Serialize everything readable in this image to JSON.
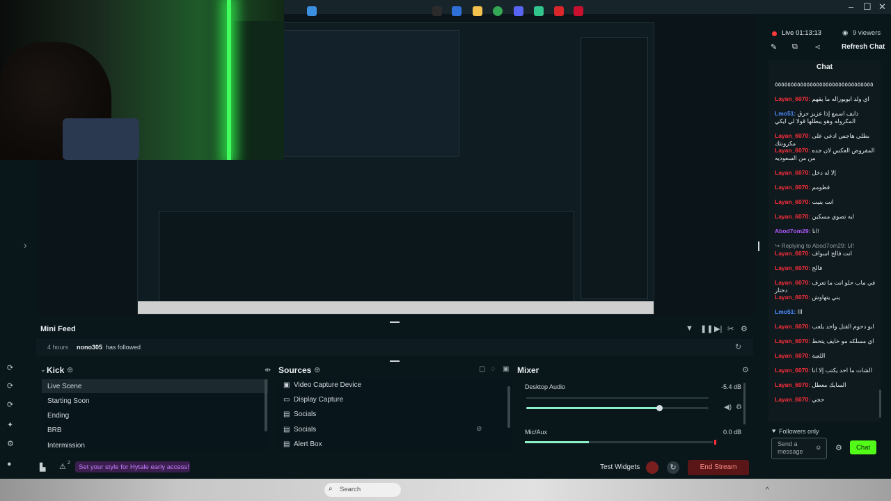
{
  "stream": {
    "live_label": "Live 01:13:13",
    "viewers_label": "9 viewers",
    "refresh_chat": "Refresh Chat",
    "chat_title": "Chat"
  },
  "minifeed": {
    "title": "Mini Feed",
    "time": "4 hours",
    "user": "nono305",
    "action": "has followed"
  },
  "scenes": {
    "title": "Kick",
    "items": [
      "Live Scene",
      "Starting Soon",
      "Ending",
      "BRB",
      "Intermission"
    ]
  },
  "sources": {
    "title": "Sources",
    "items": [
      "Video Capture Device",
      "Display Capture",
      "Socials",
      "Socials",
      "Alert Box"
    ]
  },
  "mixer": {
    "title": "Mixer",
    "channels": [
      {
        "name": "Desktop Audio",
        "db": "-5.4 dB",
        "level": 0.73
      },
      {
        "name": "Mic/Aux",
        "db": "0.0 dB",
        "level": 0.34
      }
    ]
  },
  "bottom": {
    "banner": "Set your style for Hytale early access!",
    "test_widgets": "Test Widgets",
    "end_stream": "End Stream",
    "alert_count": "2"
  },
  "taskbar": {
    "search_placeholder": "Search"
  },
  "chat": {
    "messages": [
      {
        "user": "",
        "text": "٥٥٥٥٥٥٥٥٥٥٥٥٥٥٥٥٥٥٥٥٥٥٥٥٥٥٥٥٥٥٥",
        "color": "#e2e8ea"
      },
      {
        "user": "Layan_6070",
        "text": "اي ولد ابويوراله ما يقهم",
        "color": "#ff2e3b"
      },
      {
        "user": "Lmo51",
        "text": "ذايف اسمع إذا عزيز حرق المكروله وهو يبطلها قولا لي ايكي",
        "color": "#4d8cff"
      },
      {
        "user": "Layan_6070",
        "text": "بطلي هاجس ادعي على مكرونتك",
        "color": "#ff2e3b"
      },
      {
        "user": "Layan_6070",
        "text": "المفروض العكس لان جده من من السعوديه",
        "color": "#ff2e3b"
      },
      {
        "user": "Layan_6070",
        "text": "إلا له دخل",
        "color": "#ff2e3b"
      },
      {
        "user": "Layan_6070",
        "text": "فطومم",
        "color": "#ff2e3b"
      },
      {
        "user": "Layan_6070",
        "text": "انت بنيت",
        "color": "#ff2e3b"
      },
      {
        "user": "Layan_6070",
        "text": "ايه تصوي مسكين",
        "color": "#ff2e3b"
      },
      {
        "user": "Abod7om29",
        "text": "انا!",
        "color": "#b158ff"
      },
      {
        "user": "Layan_6070",
        "text": "انت فالح اسواف",
        "color": "#ff2e3b",
        "reply": "Replying to Abod7om29: انا!"
      },
      {
        "user": "Layan_6070",
        "text": "فالح",
        "color": "#ff2e3b"
      },
      {
        "user": "Layan_6070",
        "text": "في ماب حلو انت ما تعرف دختار",
        "color": "#ff2e3b"
      },
      {
        "user": "Layan_6070",
        "text": "يني يتهاوش",
        "color": "#ff2e3b"
      },
      {
        "user": "Lmo51",
        "text": "ااا",
        "color": "#4d8cff"
      },
      {
        "user": "Layan_6070",
        "text": "ابو دحوم القتل واحد يلعب",
        "color": "#ff2e3b"
      },
      {
        "user": "Layan_6070",
        "text": "اي مسلكه مو خايف يتحط",
        "color": "#ff2e3b"
      },
      {
        "user": "Layan_6070",
        "text": "اللعبة",
        "color": "#ff2e3b"
      },
      {
        "user": "Layan_6070",
        "text": "الشات ما احد يكتب إلا انا",
        "color": "#ff2e3b"
      },
      {
        "user": "Layan_6070",
        "text": "السايك معطل",
        "color": "#ff2e3b"
      },
      {
        "user": "Layan_6070",
        "text": "حجي",
        "color": "#ff2e3b"
      }
    ],
    "followers_only": "Followers only",
    "send_placeholder": "Send a message",
    "send_button": "Chat"
  },
  "colors": {
    "accent_green": "#53fc18",
    "end_stream": "#6a1a1a",
    "banner_purple": "#c77dff"
  }
}
